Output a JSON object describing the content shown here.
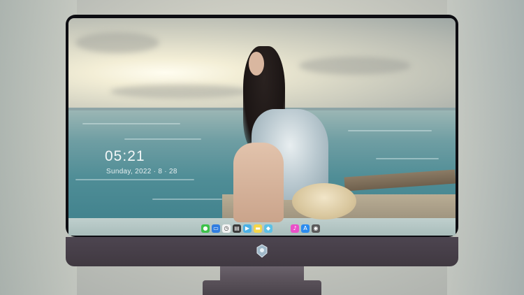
{
  "lockscreen": {
    "time": "05:21",
    "date": "Sunday, 2022 · 8 · 28"
  },
  "dock": {
    "left_icons": [
      {
        "name": "messages-icon",
        "color": "#3cc24a",
        "glyph": "●"
      },
      {
        "name": "files-icon",
        "color": "#2f7de1",
        "glyph": "▭"
      },
      {
        "name": "clock-icon",
        "color": "#f2f2f2",
        "glyph": "◷"
      },
      {
        "name": "clapper-icon",
        "color": "#3a3a3a",
        "glyph": "▤"
      },
      {
        "name": "video-icon",
        "color": "#4ab0e6",
        "glyph": "▶"
      },
      {
        "name": "notes-icon",
        "color": "#f5d547",
        "glyph": "▬"
      },
      {
        "name": "photos-icon",
        "color": "#5cc0e6",
        "glyph": "◆"
      }
    ],
    "right_icons": [
      {
        "name": "music-icon",
        "color": "#ea4fc8",
        "glyph": "♪"
      },
      {
        "name": "app-store-icon",
        "color": "#2a8bf0",
        "glyph": "A"
      },
      {
        "name": "camera-icon",
        "color": "#5a5a5a",
        "glyph": "◉"
      }
    ]
  },
  "colors": {
    "monitor_chin": "#463f48",
    "bezel": "#0d0d12"
  }
}
